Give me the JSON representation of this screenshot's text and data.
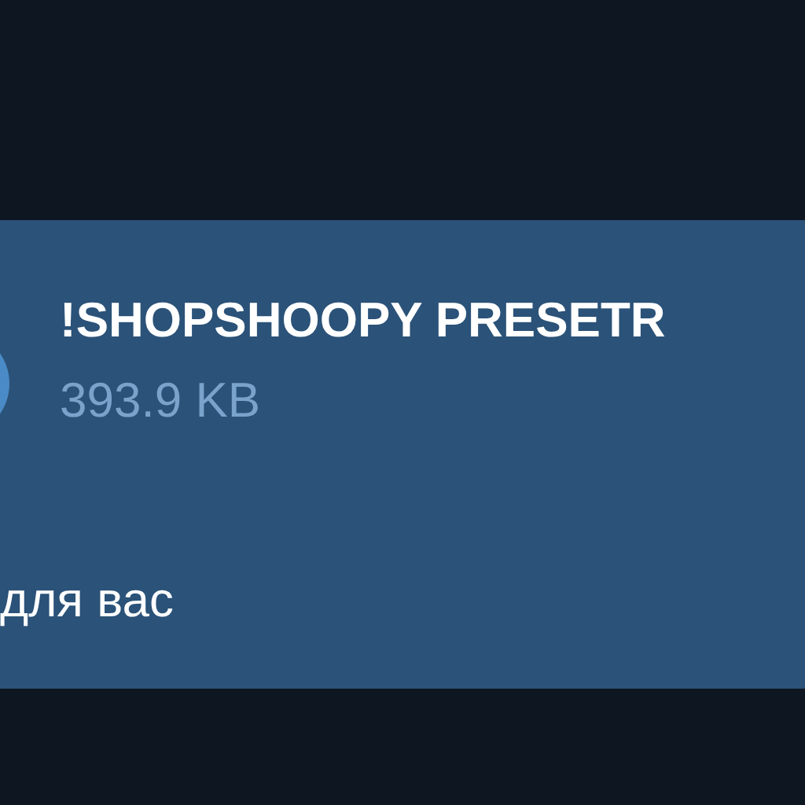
{
  "message": {
    "file": {
      "name": "!SHOPSHOOPY PRESETR",
      "size": "393.9 KB"
    },
    "caption": "для вас"
  }
}
